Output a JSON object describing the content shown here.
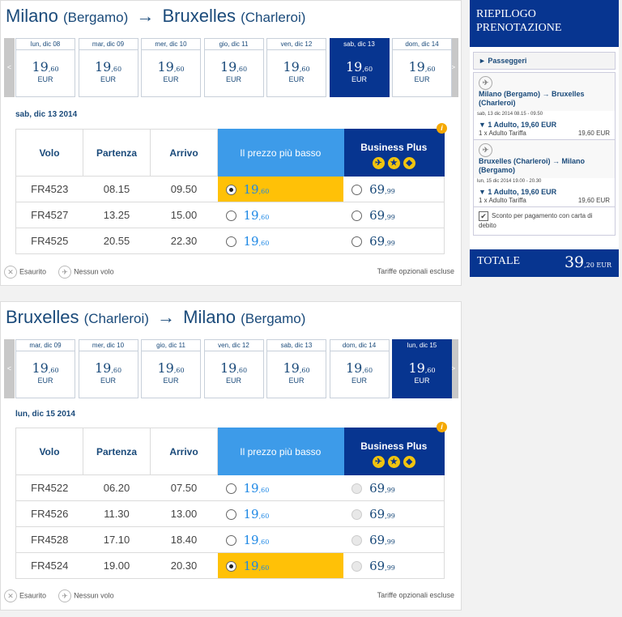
{
  "outbound": {
    "from": "Milano",
    "from_airport": "(Bergamo)",
    "arrow": "→",
    "to": "Bruxelles",
    "to_airport": "(Charleroi)",
    "days": [
      {
        "label": "lun, dic 08",
        "int": "19",
        "dec": ",60",
        "cur": "EUR",
        "selected": false
      },
      {
        "label": "mar, dic 09",
        "int": "19",
        "dec": ",60",
        "cur": "EUR",
        "selected": false
      },
      {
        "label": "mer, dic 10",
        "int": "19",
        "dec": ",60",
        "cur": "EUR",
        "selected": false
      },
      {
        "label": "gio, dic 11",
        "int": "19",
        "dec": ",60",
        "cur": "EUR",
        "selected": false
      },
      {
        "label": "ven, dic 12",
        "int": "19",
        "dec": ",60",
        "cur": "EUR",
        "selected": false
      },
      {
        "label": "sab, dic 13",
        "int": "19",
        "dec": ",60",
        "cur": "EUR",
        "selected": true
      },
      {
        "label": "dom, dic 14",
        "int": "19",
        "dec": ",60",
        "cur": "EUR",
        "selected": false
      }
    ],
    "date_header": "sab, dic 13 2014",
    "flights": [
      {
        "volo": "FR4523",
        "partenza": "08.15",
        "arrivo": "09.50",
        "low_int": "19",
        "low_dec": ",60",
        "bp_int": "69",
        "bp_dec": ",99",
        "low_selected": true
      },
      {
        "volo": "FR4527",
        "partenza": "13.25",
        "arrivo": "15.00",
        "low_int": "19",
        "low_dec": ",60",
        "bp_int": "69",
        "bp_dec": ",99",
        "low_selected": false
      },
      {
        "volo": "FR4525",
        "partenza": "20.55",
        "arrivo": "22.30",
        "low_int": "19",
        "low_dec": ",60",
        "bp_int": "69",
        "bp_dec": ",99",
        "low_selected": false
      }
    ]
  },
  "inbound": {
    "from": "Bruxelles",
    "from_airport": "(Charleroi)",
    "arrow": "→",
    "to": "Milano",
    "to_airport": "(Bergamo)",
    "days": [
      {
        "label": "mar, dic 09",
        "int": "19",
        "dec": ",60",
        "cur": "EUR",
        "selected": false
      },
      {
        "label": "mer, dic 10",
        "int": "19",
        "dec": ",60",
        "cur": "EUR",
        "selected": false
      },
      {
        "label": "gio, dic 11",
        "int": "19",
        "dec": ",60",
        "cur": "EUR",
        "selected": false
      },
      {
        "label": "ven, dic 12",
        "int": "19",
        "dec": ",60",
        "cur": "EUR",
        "selected": false
      },
      {
        "label": "sab, dic 13",
        "int": "19",
        "dec": ",60",
        "cur": "EUR",
        "selected": false
      },
      {
        "label": "dom, dic 14",
        "int": "19",
        "dec": ",60",
        "cur": "EUR",
        "selected": false
      },
      {
        "label": "lun, dic 15",
        "int": "19",
        "dec": ",60",
        "cur": "EUR",
        "selected": true
      }
    ],
    "date_header": "lun, dic 15 2014",
    "flights": [
      {
        "volo": "FR4522",
        "partenza": "06.20",
        "arrivo": "07.50",
        "low_int": "19",
        "low_dec": ",60",
        "bp_int": "69",
        "bp_dec": ",99",
        "low_selected": false
      },
      {
        "volo": "FR4526",
        "partenza": "11.30",
        "arrivo": "13.00",
        "low_int": "19",
        "low_dec": ",60",
        "bp_int": "69",
        "bp_dec": ",99",
        "low_selected": false
      },
      {
        "volo": "FR4528",
        "partenza": "17.10",
        "arrivo": "18.40",
        "low_int": "19",
        "low_dec": ",60",
        "bp_int": "69",
        "bp_dec": ",99",
        "low_selected": false
      },
      {
        "volo": "FR4524",
        "partenza": "19.00",
        "arrivo": "20.30",
        "low_int": "19",
        "low_dec": ",60",
        "bp_int": "69",
        "bp_dec": ",99",
        "low_selected": true
      }
    ]
  },
  "table_headers": {
    "volo": "Volo",
    "partenza": "Partenza",
    "arrivo": "Arrivo",
    "low": "Il prezzo più basso",
    "bp": "Business Plus"
  },
  "legend": {
    "sold_out": "Esaurito",
    "no_flight": "Nessun volo",
    "optional": "Tariffe opzionali escluse"
  },
  "summary": {
    "title": "RIEPILOGO PRENOTAZIONE",
    "passengers": "► Passeggeri",
    "leg1_route": "Milano (Bergamo) → Bruxelles (Charleroi)",
    "leg1_date": "sab, 13 dic 2014 08.15 - 09.50",
    "leg1_adult": "▼ 1 Adulto, 19,60 EUR",
    "leg1_fare_label": "1 x Adulto Tariffa",
    "leg1_fare_value": "19,60 EUR",
    "leg2_route": "Bruxelles (Charleroi) → Milano (Bergamo)",
    "leg2_date": "lun, 15 dic 2014 19.00 - 20.30",
    "leg2_adult": "▼ 1 Adulto, 19,60 EUR",
    "leg2_fare_label": "1 x Adulto Tariffa",
    "leg2_fare_value": "19,60 EUR",
    "discount": "Sconto per pagamento con carta di debito",
    "total_label": "TOTALE",
    "total_int": "39",
    "total_dec": ",20 EUR"
  },
  "colors": {
    "brand_navy": "#073590",
    "low_fare_blue": "#3d9be9",
    "selected_yellow": "#ffc107"
  }
}
